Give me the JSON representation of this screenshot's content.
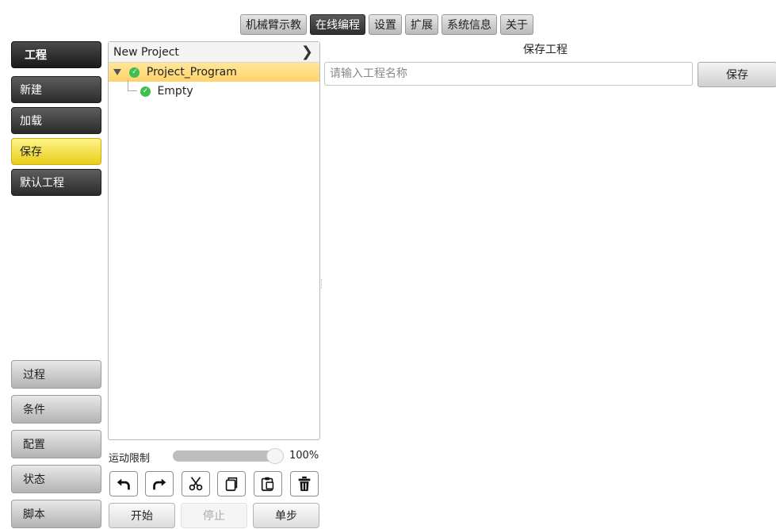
{
  "top_tabs": [
    {
      "label": "机械臂示教",
      "active": false
    },
    {
      "label": "在线编程",
      "active": true
    },
    {
      "label": "设置",
      "active": false
    },
    {
      "label": "扩展",
      "active": false
    },
    {
      "label": "系统信息",
      "active": false
    },
    {
      "label": "关于",
      "active": false
    }
  ],
  "sidebar": {
    "header": "工程",
    "items": [
      {
        "label": "新建",
        "state": "normal"
      },
      {
        "label": "加载",
        "state": "normal"
      },
      {
        "label": "保存",
        "state": "selected"
      },
      {
        "label": "默认工程",
        "state": "normal"
      }
    ],
    "bottom_items": [
      "过程",
      "条件",
      "配置",
      "状态",
      "脚本"
    ]
  },
  "tree": {
    "header": "New Project",
    "nodes": [
      {
        "label": "Project_Program",
        "selected": true,
        "expanded": true
      },
      {
        "label": "Empty",
        "selected": false
      }
    ]
  },
  "save_panel": {
    "title": "保存工程",
    "input_placeholder": "请输入工程名称",
    "input_value": "",
    "save_label": "保存"
  },
  "motion_limit": {
    "label": "运动限制",
    "value_text": "100%",
    "value_fraction": 1.0
  },
  "toolbar_icons": [
    "undo-icon",
    "redo-icon",
    "cut-icon",
    "copy-icon",
    "paste-icon",
    "delete-icon"
  ],
  "run_buttons": {
    "start": "开始",
    "stop": "停止",
    "step": "单步"
  },
  "colors": {
    "active_tab": "#2e2e2e",
    "selected_yellow": "#e9cd1a",
    "tree_selected": "#ffd36a",
    "check_green": "#3fbf4f"
  }
}
